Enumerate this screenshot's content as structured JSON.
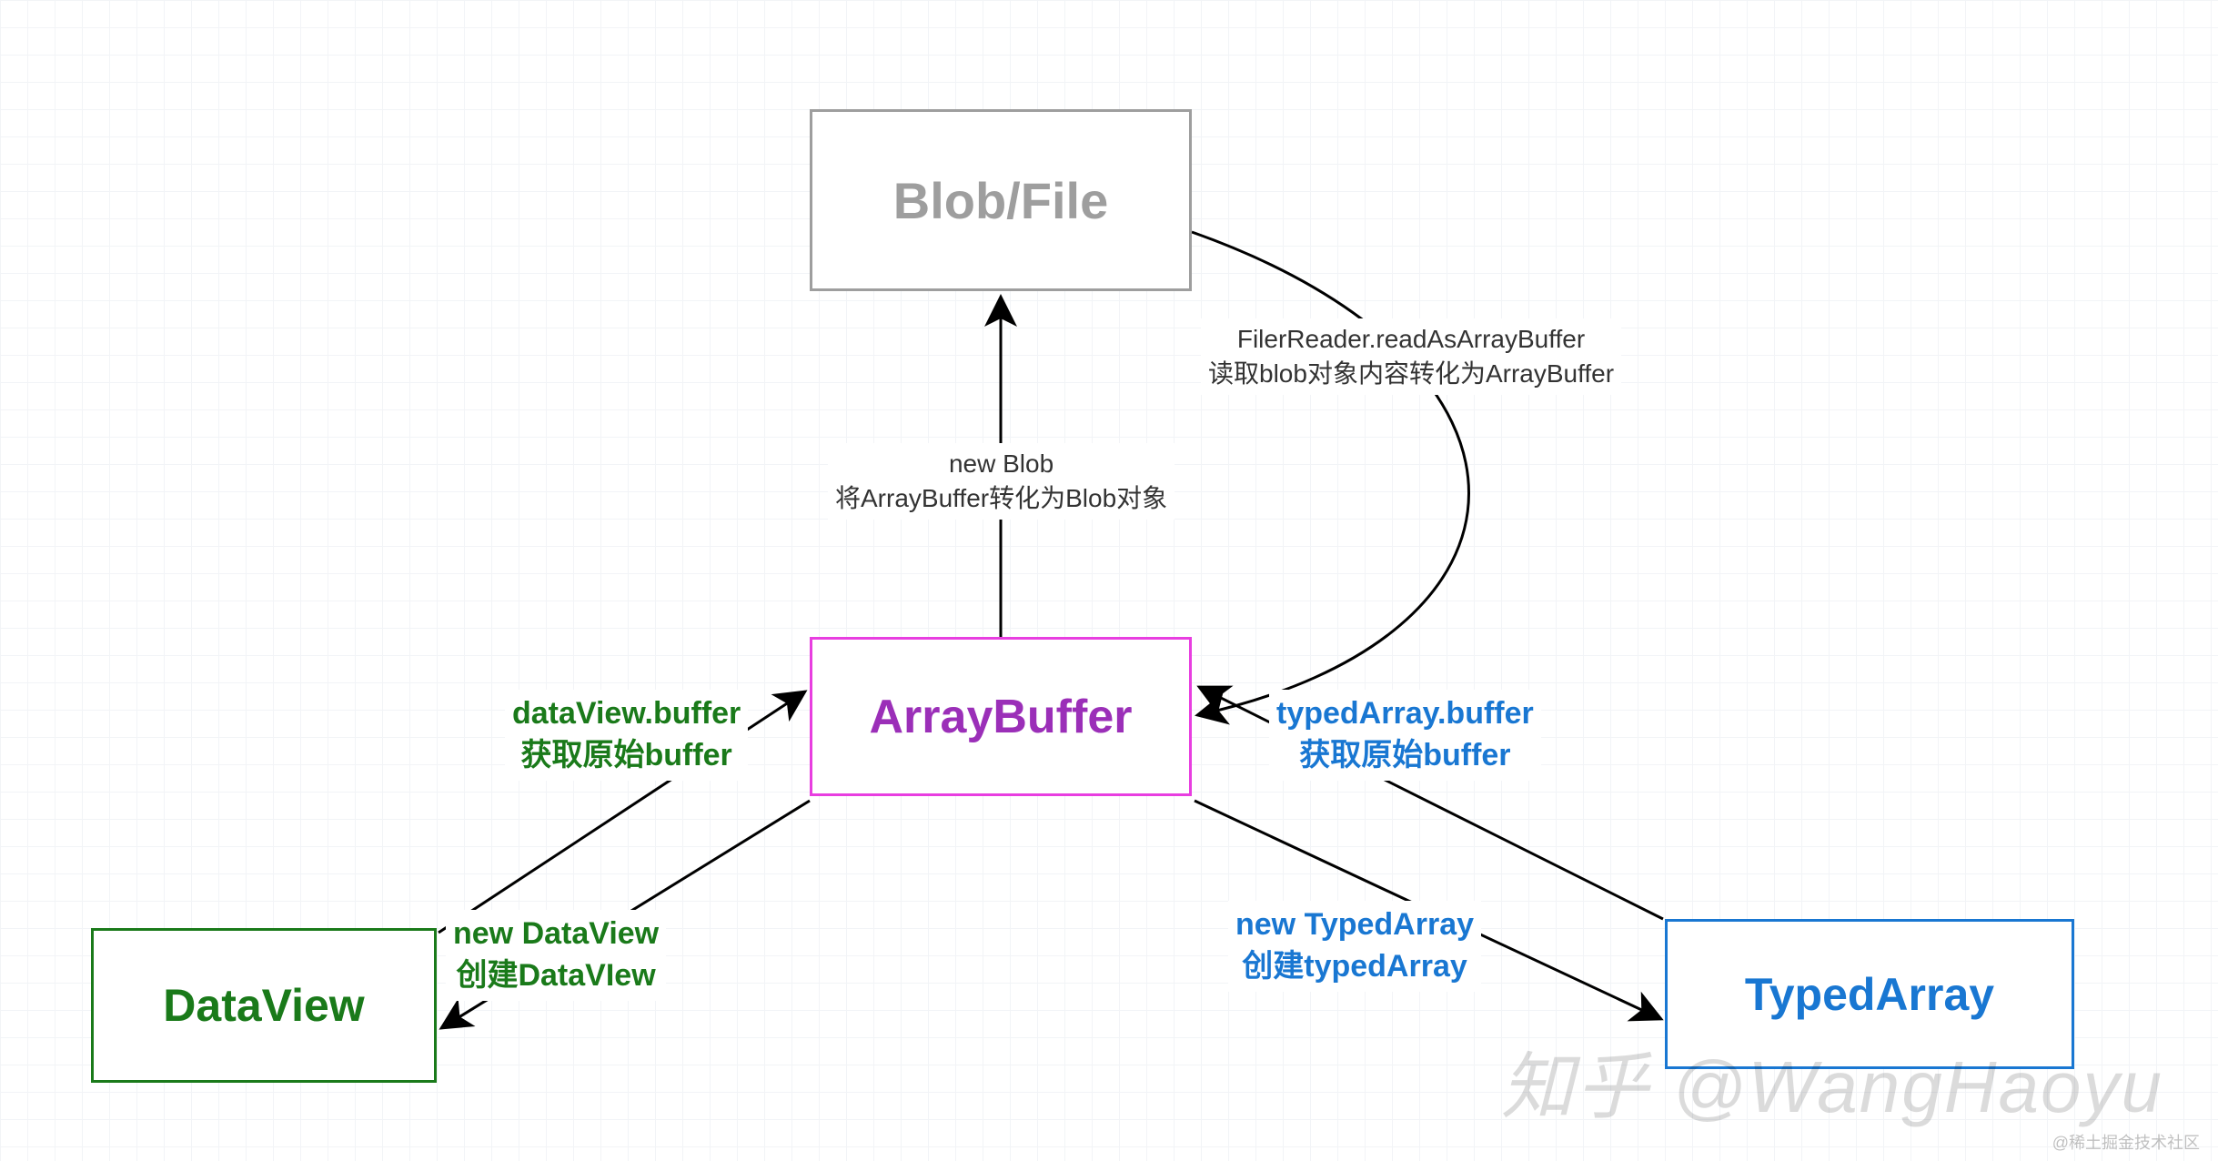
{
  "nodes": {
    "blob": "Blob/File",
    "arraybuffer": "ArrayBuffer",
    "dataview": "DataView",
    "typedarray": "TypedArray"
  },
  "edges": {
    "blob_to_buffer": {
      "line1": "FilerReader.readAsArrayBuffer",
      "line2": "读取blob对象内容转化为ArrayBuffer"
    },
    "buffer_to_blob": {
      "line1": "new Blob",
      "line2": "将ArrayBuffer转化为Blob对象"
    },
    "dataview_to_buffer": {
      "line1": "dataView.buffer",
      "line2": "获取原始buffer"
    },
    "buffer_to_dataview": {
      "line1": "new DataView",
      "line2": "创建DataVIew"
    },
    "typedarray_to_buffer": {
      "line1": "typedArray.buffer",
      "line2": "获取原始buffer"
    },
    "buffer_to_typedarray": {
      "line1": "new TypedArray",
      "line2": "创建typedArray"
    }
  },
  "watermark": "知乎 @WangHaoyu",
  "watermark_small": "@稀土掘金技术社区"
}
